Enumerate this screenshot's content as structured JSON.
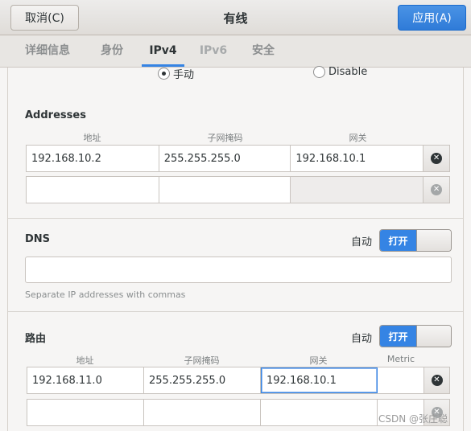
{
  "header": {
    "cancel_label": "取消(C)",
    "title": "有线",
    "apply_label": "应用(A)"
  },
  "tabs": [
    {
      "label": "详细信息"
    },
    {
      "label": "身份"
    },
    {
      "label": "IPv4"
    },
    {
      "label": "IPv6"
    },
    {
      "label": "安全"
    }
  ],
  "method": {
    "manual_label": "手动",
    "disable_label": "Disable",
    "selected": "手动"
  },
  "addresses": {
    "title": "Addresses",
    "headers": [
      "地址",
      "子网掩码",
      "网关"
    ],
    "rows": [
      {
        "address": "192.168.10.2",
        "netmask": "255.255.255.0",
        "gateway": "192.168.10.1"
      },
      {
        "address": "",
        "netmask": "",
        "gateway": ""
      }
    ]
  },
  "dns": {
    "title": "DNS",
    "auto_label": "自动",
    "toggle_label": "打开",
    "value": "",
    "hint": "Separate IP addresses with commas"
  },
  "routes": {
    "title": "路由",
    "auto_label": "自动",
    "toggle_label": "打开",
    "headers": [
      "地址",
      "子网掩码",
      "网关",
      "Metric"
    ],
    "rows": [
      {
        "address": "192.168.11.0",
        "netmask": "255.255.255.0",
        "gateway": "192.168.10.1",
        "metric": ""
      },
      {
        "address": "",
        "netmask": "",
        "gateway": "",
        "metric": ""
      }
    ]
  },
  "watermark": "CSDN @张庄聪",
  "colors": {
    "accent": "#3584e4"
  }
}
